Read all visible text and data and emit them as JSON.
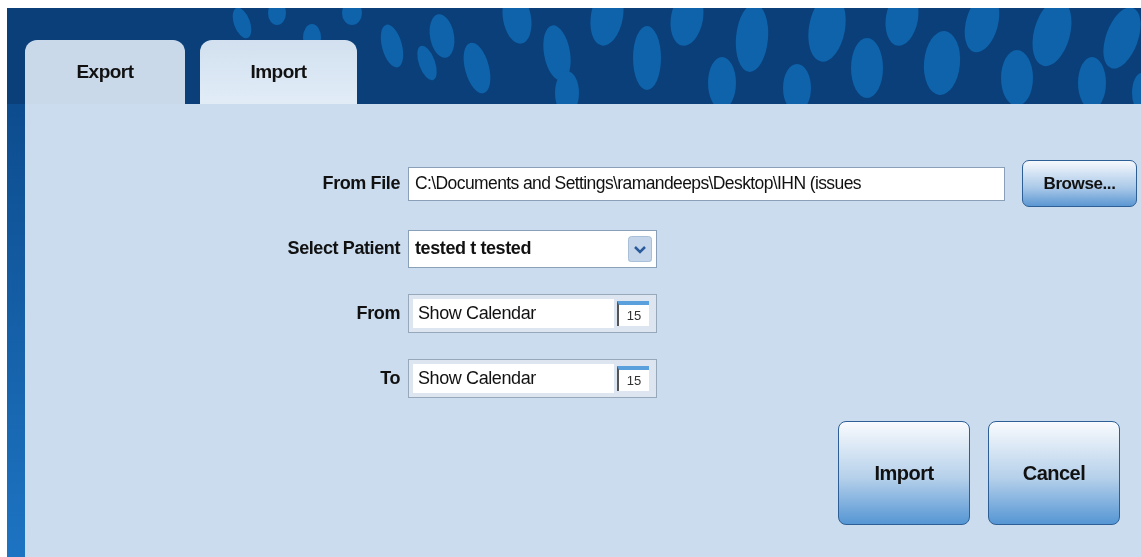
{
  "tabs": [
    {
      "label": "Export",
      "selected": false
    },
    {
      "label": "Import",
      "selected": true
    }
  ],
  "form": {
    "from_file": {
      "label": "From File",
      "value": "C:\\Documents and Settings\\ramandeeps\\Desktop\\IHN (issues",
      "button": "Browse..."
    },
    "select_patient": {
      "label": "Select Patient",
      "value": "tested t tested"
    },
    "dates": [
      {
        "label": "From",
        "value": "Show Calendar",
        "calendar_day": "15"
      },
      {
        "label": "To",
        "value": "Show Calendar",
        "calendar_day": "15"
      }
    ]
  },
  "buttons": [
    "Import",
    "Cancel"
  ]
}
